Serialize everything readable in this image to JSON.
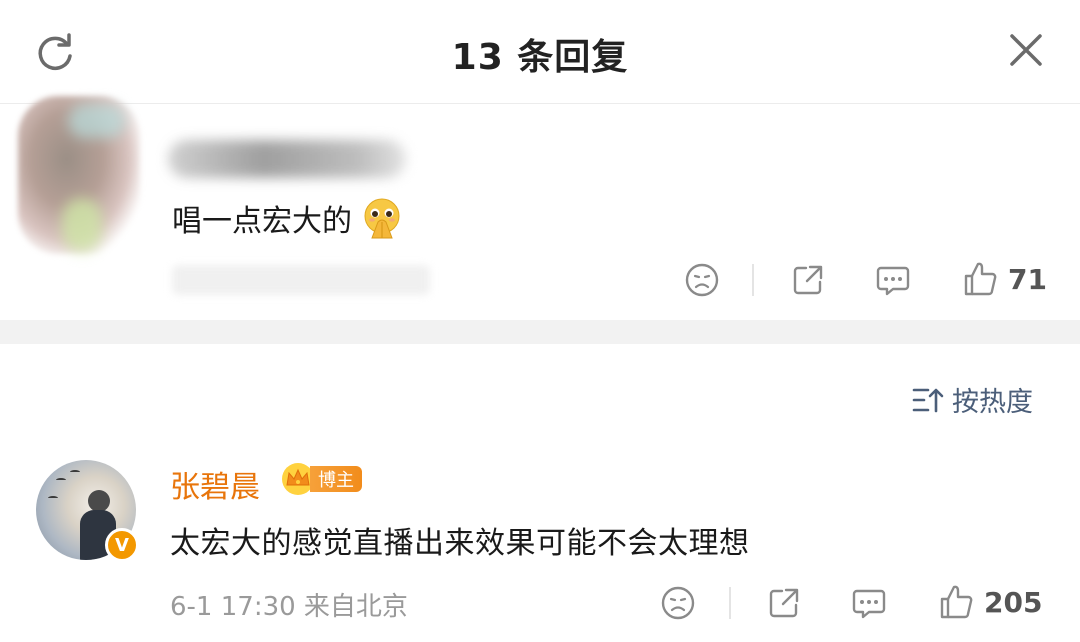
{
  "header": {
    "title": "13 条回复"
  },
  "top_comment": {
    "text": "唱一点宏大的",
    "likes": "71"
  },
  "sort": {
    "label": "按热度"
  },
  "reply": {
    "author": "张碧晨",
    "author_color": "#e8750b",
    "badge_label": "博主",
    "verified_mark": "V",
    "text": "太宏大的感觉直播出来效果可能不会太理想",
    "meta": "6-1 17:30 来自北京",
    "likes": "205"
  },
  "icons": [
    "refresh-icon",
    "close-icon",
    "dislike-face-icon",
    "share-icon",
    "comment-icon",
    "thumbs-up-icon",
    "sort-icon",
    "crown-icon",
    "pray-emoji-icon"
  ],
  "colors": {
    "accent_orange": "#f39800",
    "sort_blue": "#4b5e79",
    "icon_gray": "#8a8a8a"
  }
}
